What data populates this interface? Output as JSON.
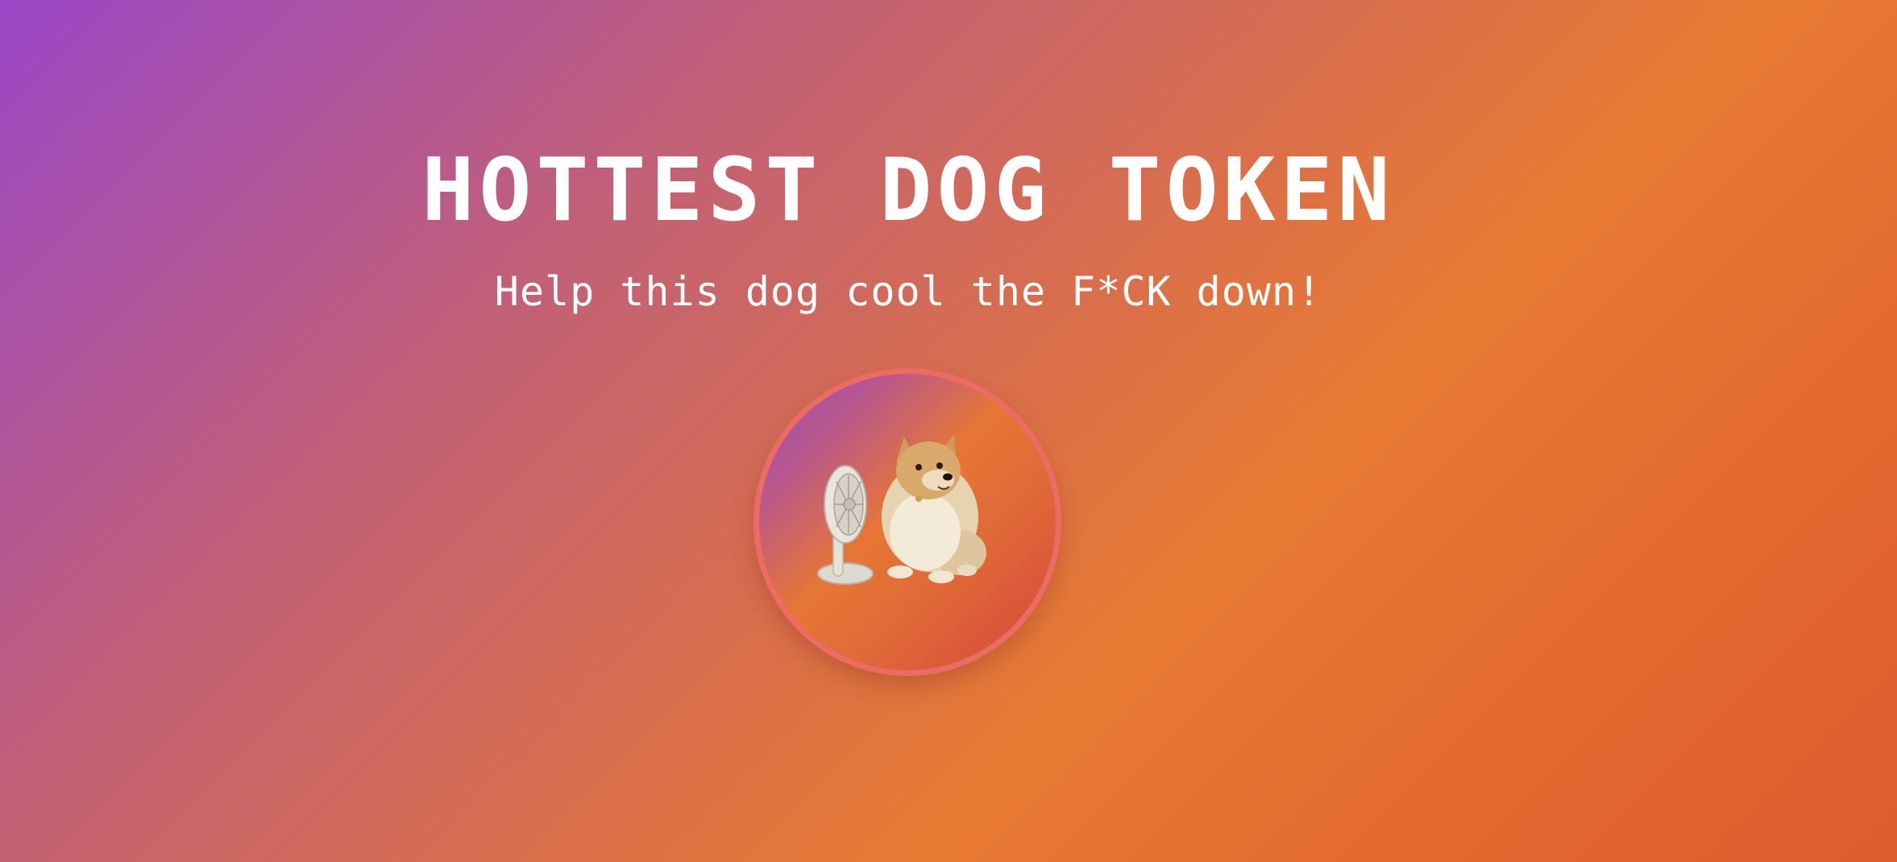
{
  "hero": {
    "title": "HOTTEST DOG TOKEN",
    "subtitle": "Help this dog cool the F*CK down!"
  },
  "mascot": {
    "icons": [
      "desk-fan-icon",
      "pomeranian-dog-icon"
    ]
  },
  "colors": {
    "gradient_start": "#9a47c7",
    "gradient_mid": "#e87a33",
    "gradient_end": "#dd5c30",
    "text": "#ffffff",
    "avatar_border": "#ec6c64"
  }
}
